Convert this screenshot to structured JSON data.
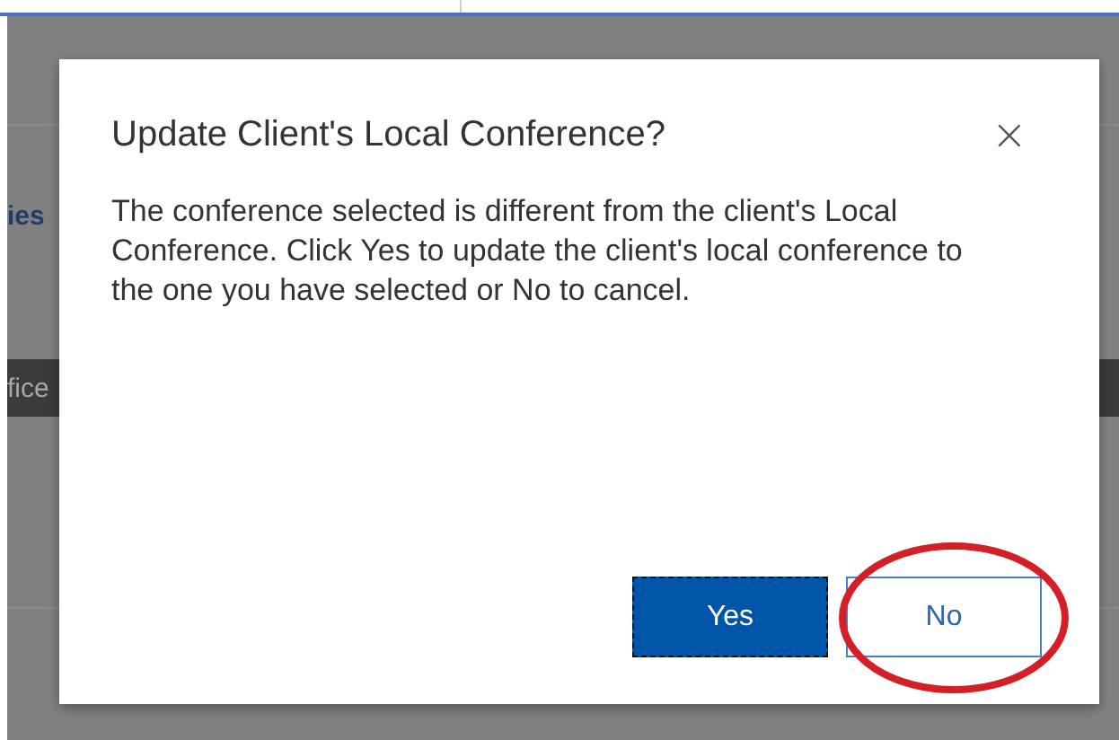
{
  "background": {
    "fragments": [
      {
        "kind": "heading",
        "text": "ies"
      },
      {
        "kind": "band",
        "text": "fice"
      }
    ]
  },
  "dialog": {
    "title": "Update Client's Local Conference?",
    "close": "×",
    "message": "The conference selected is different from the client's Local Conference. Click Yes to update the client's local conference to the one you have selected or No to cancel.",
    "buttons": [
      {
        "label": "Yes",
        "kind": "primary",
        "focused": true,
        "highlighted": false
      },
      {
        "label": "No",
        "kind": "secondary",
        "focused": false,
        "highlighted": true
      }
    ]
  }
}
